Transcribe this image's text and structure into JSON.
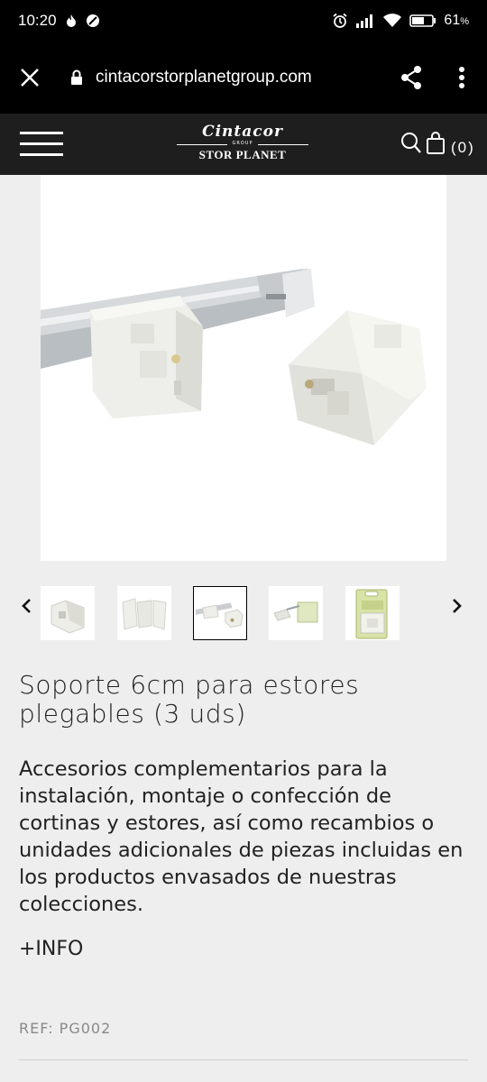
{
  "status_bar": {
    "time": "10:20",
    "battery_percent": "61",
    "battery_unit": "%",
    "icons": [
      "flame-icon",
      "circle-slash-icon",
      "alarm-icon",
      "signal-icon",
      "wifi-icon",
      "battery-icon"
    ]
  },
  "browser": {
    "url": "cintacorstorplanetgroup.com",
    "icons": [
      "close-icon",
      "lock-icon",
      "share-icon",
      "more-vert-icon"
    ]
  },
  "site_header": {
    "logo_brand": "Cintacor",
    "logo_group": "GROUP",
    "logo_sub": "STOR PLANET",
    "cart_count": "(0)",
    "icons": [
      "menu-icon",
      "search-icon",
      "cart-icon"
    ]
  },
  "product": {
    "title": "Soporte 6cm para estores plegables (3 uds)",
    "description": "Accesorios complementarios para la instalación, montaje o confección de cortinas y estores, así como recambios o unidades adicionales de piezas incluidas en los productos envasados de nuestras colecciones.",
    "more_info": "+INFO",
    "ref": "REF: PG002",
    "thumbnails_count": 5,
    "active_thumbnail": 3
  },
  "colors": {
    "topbar": "#000000",
    "site_header": "#1e1e1e",
    "page_bg": "#eeeeee",
    "text": "#222222",
    "ref_text": "#888888"
  }
}
